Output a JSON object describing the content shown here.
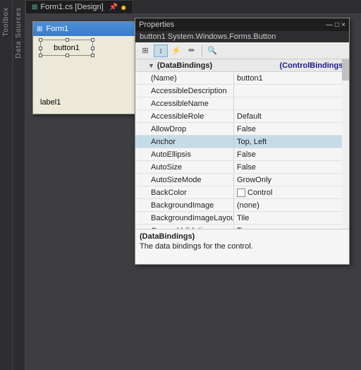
{
  "tab": {
    "icon": "⊞",
    "label": "Form1.cs [Design]",
    "close_icon": "×",
    "dot": "●"
  },
  "toolbox": {
    "label": "Toolbox"
  },
  "datasources": {
    "label": "Data Sources"
  },
  "form": {
    "title": "Form1",
    "button_label": "button1",
    "label_text": "label1"
  },
  "properties": {
    "title": "Properties",
    "subtitle": "button1  System.Windows.Forms.Button",
    "minimize": "—",
    "maximize": "□",
    "close": "×",
    "group_header": {
      "name": "(DataBindings)",
      "value": "(ControlBindings)"
    },
    "rows": [
      {
        "name": "(Name)",
        "value": "button1"
      },
      {
        "name": "AccessibleDescription",
        "value": ""
      },
      {
        "name": "AccessibleName",
        "value": ""
      },
      {
        "name": "AccessibleRole",
        "value": "Default"
      },
      {
        "name": "AllowDrop",
        "value": "False"
      },
      {
        "name": "Anchor",
        "value": "Top, Left"
      },
      {
        "name": "AutoEllipsis",
        "value": "False"
      },
      {
        "name": "AutoSize",
        "value": "False"
      },
      {
        "name": "AutoSizeMode",
        "value": "GrowOnly"
      },
      {
        "name": "BackColor",
        "value": "Control",
        "has_swatch": true
      },
      {
        "name": "BackgroundImage",
        "value": "(none)"
      },
      {
        "name": "BackgroundImageLayout",
        "value": "Tile"
      },
      {
        "name": "CausesValidation",
        "value": "True"
      }
    ],
    "description": {
      "title": "(DataBindings)",
      "text": "The data bindings for the control."
    }
  },
  "toolbar": {
    "buttons": [
      "⊞",
      "↕",
      "⚡",
      "✏",
      "🔍"
    ]
  }
}
